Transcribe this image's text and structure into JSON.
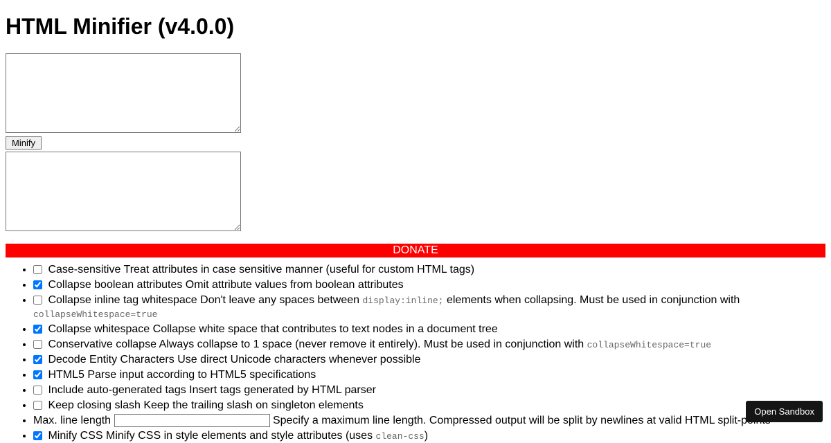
{
  "title": "HTML Minifier (v4.0.0)",
  "minify_button": "Minify",
  "donate_label": "DONATE",
  "sandbox_button": "Open Sandbox",
  "options": [
    {
      "checked": false,
      "label": "Case-sensitive",
      "desc_pre": " Treat attributes in case sensitive manner (useful for custom HTML tags)",
      "code1": "",
      "desc_mid": "",
      "code2": ""
    },
    {
      "checked": true,
      "label": "Collapse boolean attributes",
      "desc_pre": " Omit attribute values from boolean attributes",
      "code1": "",
      "desc_mid": "",
      "code2": ""
    },
    {
      "checked": false,
      "label": "Collapse inline tag whitespace",
      "desc_pre": " Don't leave any spaces between ",
      "code1": "display:inline;",
      "desc_mid": " elements when collapsing. Must be used in conjunction with ",
      "code2": "collapseWhitespace=true"
    },
    {
      "checked": true,
      "label": "Collapse whitespace",
      "desc_pre": " Collapse white space that contributes to text nodes in a document tree",
      "code1": "",
      "desc_mid": "",
      "code2": ""
    },
    {
      "checked": false,
      "label": "Conservative collapse",
      "desc_pre": " Always collapse to 1 space (never remove it entirely). Must be used in conjunction with ",
      "code1": "collapseWhitespace=true",
      "desc_mid": "",
      "code2": ""
    },
    {
      "checked": true,
      "label": "Decode Entity Characters",
      "desc_pre": " Use direct Unicode characters whenever possible",
      "code1": "",
      "desc_mid": "",
      "code2": ""
    },
    {
      "checked": true,
      "label": "HTML5",
      "desc_pre": " Parse input according to HTML5 specifications",
      "code1": "",
      "desc_mid": "",
      "code2": ""
    },
    {
      "checked": false,
      "label": "Include auto-generated tags",
      "desc_pre": " Insert tags generated by HTML parser",
      "code1": "",
      "desc_mid": "",
      "code2": ""
    },
    {
      "checked": false,
      "label": "Keep closing slash",
      "desc_pre": " Keep the trailing slash on singleton elements",
      "code1": "",
      "desc_mid": "",
      "code2": ""
    }
  ],
  "maxline": {
    "label": "Max. line length ",
    "value": "",
    "desc": " Specify a maximum line length. Compressed output will be split by newlines at valid HTML split-points"
  },
  "minifycss": {
    "checked": true,
    "label": "Minify CSS",
    "desc_pre": " Minify CSS in style elements and style attributes (uses ",
    "code": "clean-css",
    "desc_post": ")"
  }
}
